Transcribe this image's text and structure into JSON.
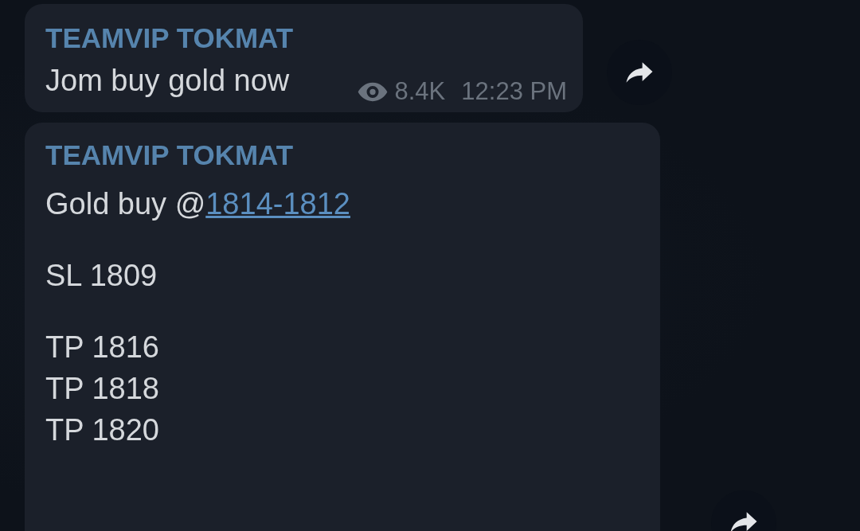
{
  "messages": [
    {
      "sender": "TEAMVIP TOKMAT",
      "text": "Jom buy gold now",
      "views": "8.4K",
      "time": "12:23 PM"
    },
    {
      "sender": "TEAMVIP TOKMAT",
      "paragraphs": [
        {
          "lines": [
            {
              "text": "Gold buy @",
              "link": "1814-1812"
            }
          ]
        },
        {
          "lines": [
            {
              "text": "SL 1809"
            }
          ]
        },
        {
          "lines": [
            {
              "text": "TP 1816"
            },
            {
              "text": "TP 1818"
            },
            {
              "text": "TP 1820"
            }
          ]
        }
      ]
    }
  ]
}
